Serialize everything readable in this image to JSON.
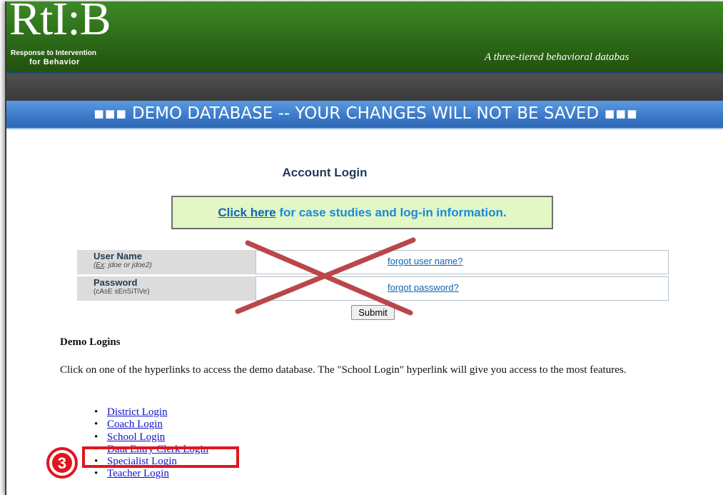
{
  "header": {
    "logo": "RtI:B",
    "logo_line1": "Response to Intervention",
    "logo_line2": "for Behavior",
    "tagline": "A three-tiered behavioral databas"
  },
  "banner": {
    "text": "▪▪▪  DEMO DATABASE -- YOUR CHANGES WILL NOT BE SAVED  ▪▪▪"
  },
  "login": {
    "title": "Account Login",
    "case_link": "Click here",
    "case_text": " for case studies and log-in information.",
    "username_label": "User Name",
    "username_hint_ex": "Ex",
    "username_hint_rest": ": jdoe or jdoe2)",
    "forgot_username": "forgot user name?",
    "password_label": "Password",
    "password_hint": "(cAsE sEnSiTiVe)",
    "forgot_password": "forgot password?",
    "submit": "Submit"
  },
  "demo": {
    "heading": "Demo Logins",
    "description": "Click on one of the hyperlinks to access the demo database. The \"School Login\" hyperlink will give you access to the most features.",
    "links": [
      "District Login",
      "Coach Login",
      "School Login",
      "Data Entry Clerk Login",
      "Specialist Login",
      "Teacher Login"
    ]
  },
  "annotation": {
    "step": "3",
    "color": "#e0161e"
  }
}
